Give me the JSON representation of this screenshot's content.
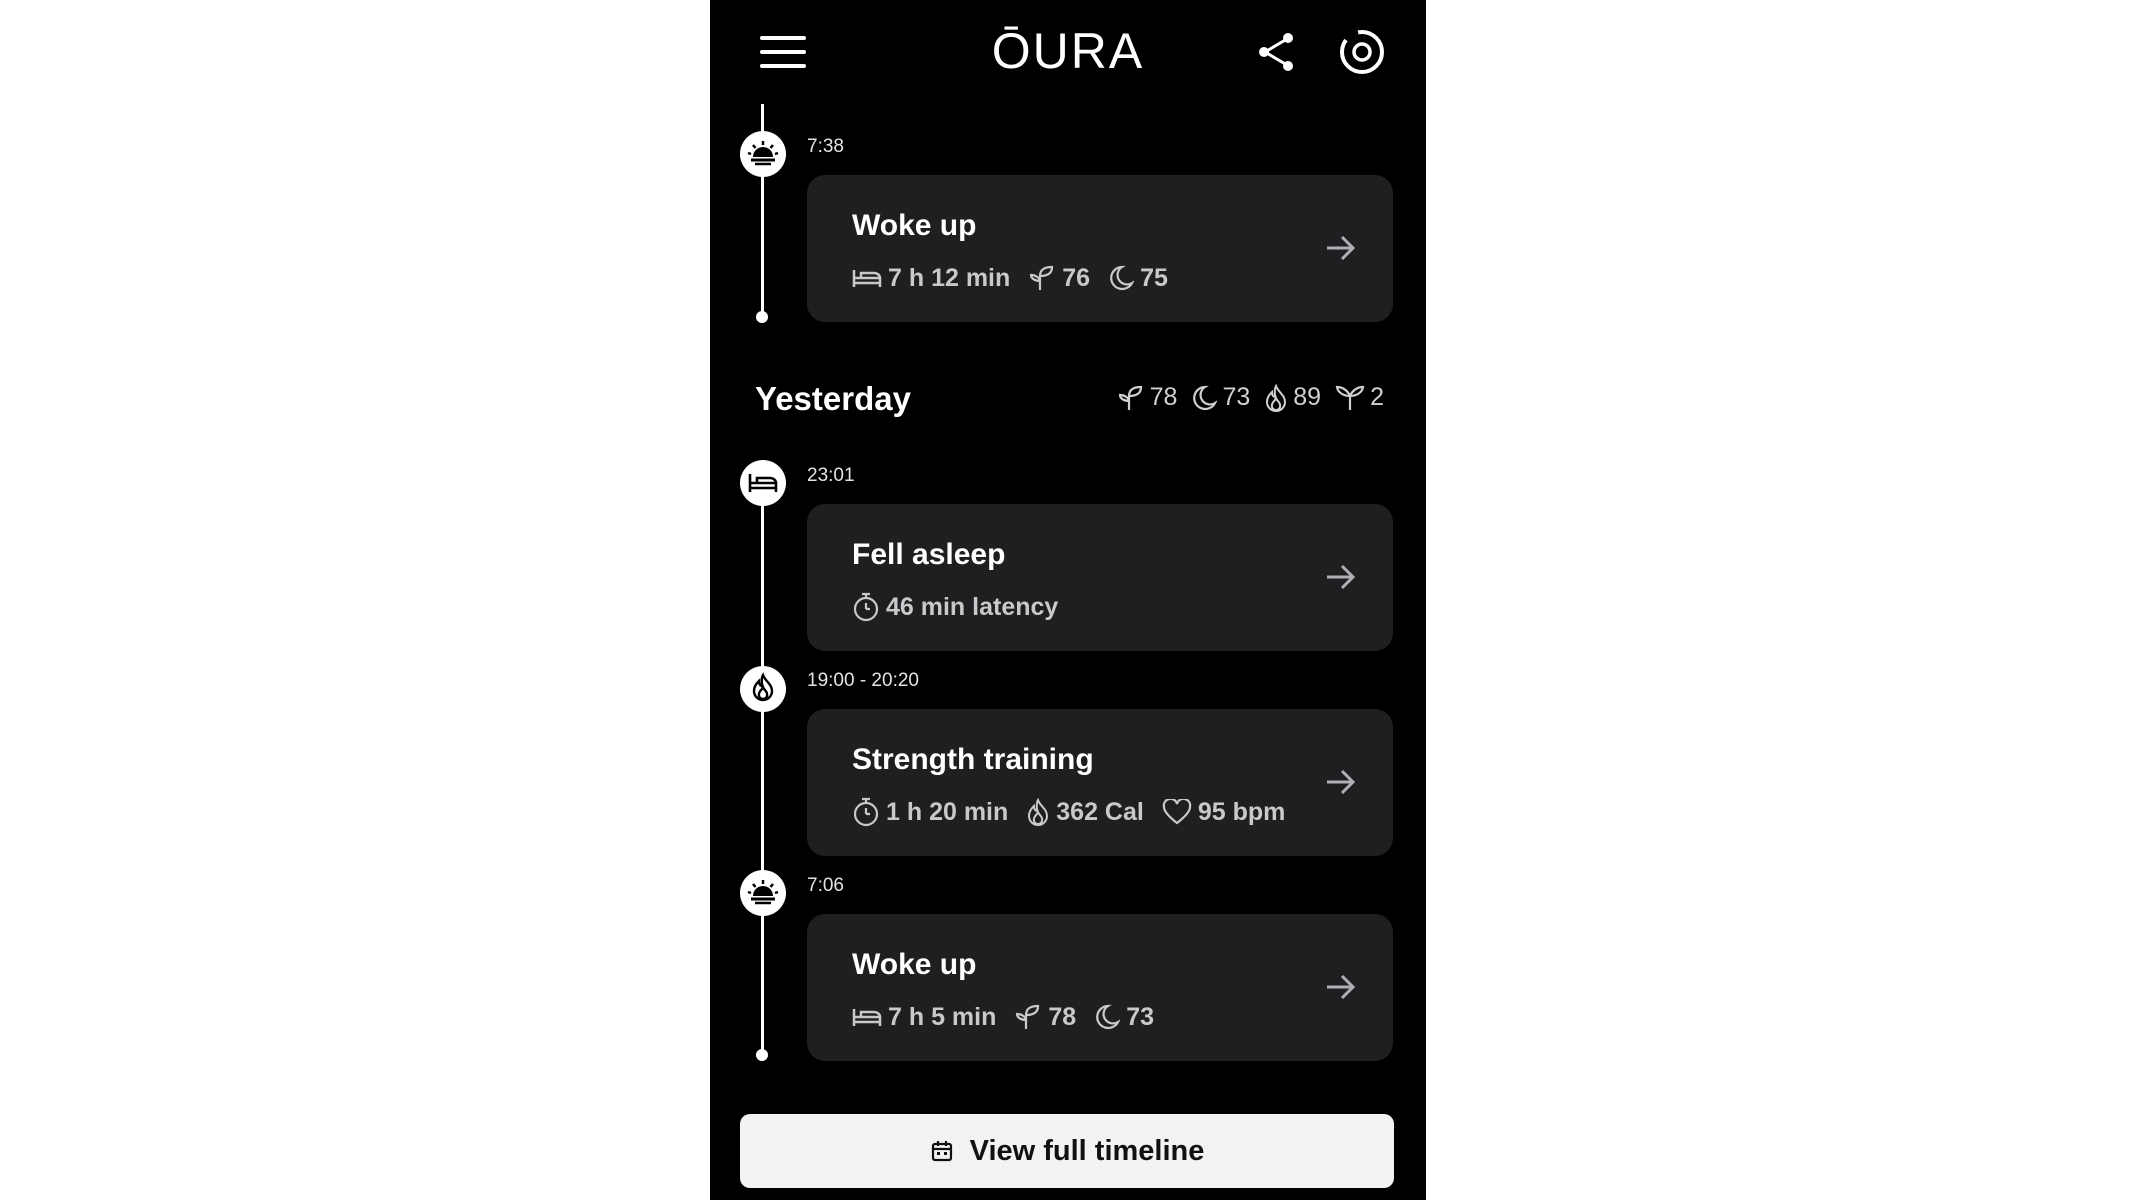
{
  "header": {
    "logo_text": "ŌURA",
    "icons": [
      "hamburger-menu-icon",
      "share-icon",
      "ring-icon"
    ]
  },
  "timeline_top": {
    "time": "7:38",
    "icon": "sunrise-icon",
    "title": "Woke up",
    "stats": [
      {
        "icon": "bed-icon",
        "value": "7 h 12 min"
      },
      {
        "icon": "readiness-sprout-icon",
        "value": "76"
      },
      {
        "icon": "moon-icon",
        "value": "75"
      }
    ]
  },
  "yesterday": {
    "label": "Yesterday",
    "summary": [
      {
        "icon": "readiness-sprout-icon",
        "value": "78"
      },
      {
        "icon": "moon-icon",
        "value": "73"
      },
      {
        "icon": "flame-icon",
        "value": "89"
      },
      {
        "icon": "resilience-plant-icon",
        "value": "2"
      }
    ],
    "events": [
      {
        "time": "23:01",
        "icon": "bed-icon",
        "title": "Fell asleep",
        "stats": [
          {
            "icon": "stopwatch-icon",
            "value": "46 min latency"
          }
        ]
      },
      {
        "time": "19:00 - 20:20",
        "icon": "flame-icon",
        "title": "Strength training",
        "stats": [
          {
            "icon": "stopwatch-icon",
            "value": "1 h 20 min"
          },
          {
            "icon": "flame-icon",
            "value": "362 Cal"
          },
          {
            "icon": "heart-icon",
            "value": "95 bpm"
          }
        ]
      },
      {
        "time": "7:06",
        "icon": "sunrise-icon",
        "title": "Woke up",
        "stats": [
          {
            "icon": "bed-icon",
            "value": "7 h 5 min"
          },
          {
            "icon": "readiness-sprout-icon",
            "value": "78"
          },
          {
            "icon": "moon-icon",
            "value": "73"
          }
        ]
      }
    ]
  },
  "cta": {
    "label": "View full timeline",
    "icon": "calendar-icon"
  }
}
